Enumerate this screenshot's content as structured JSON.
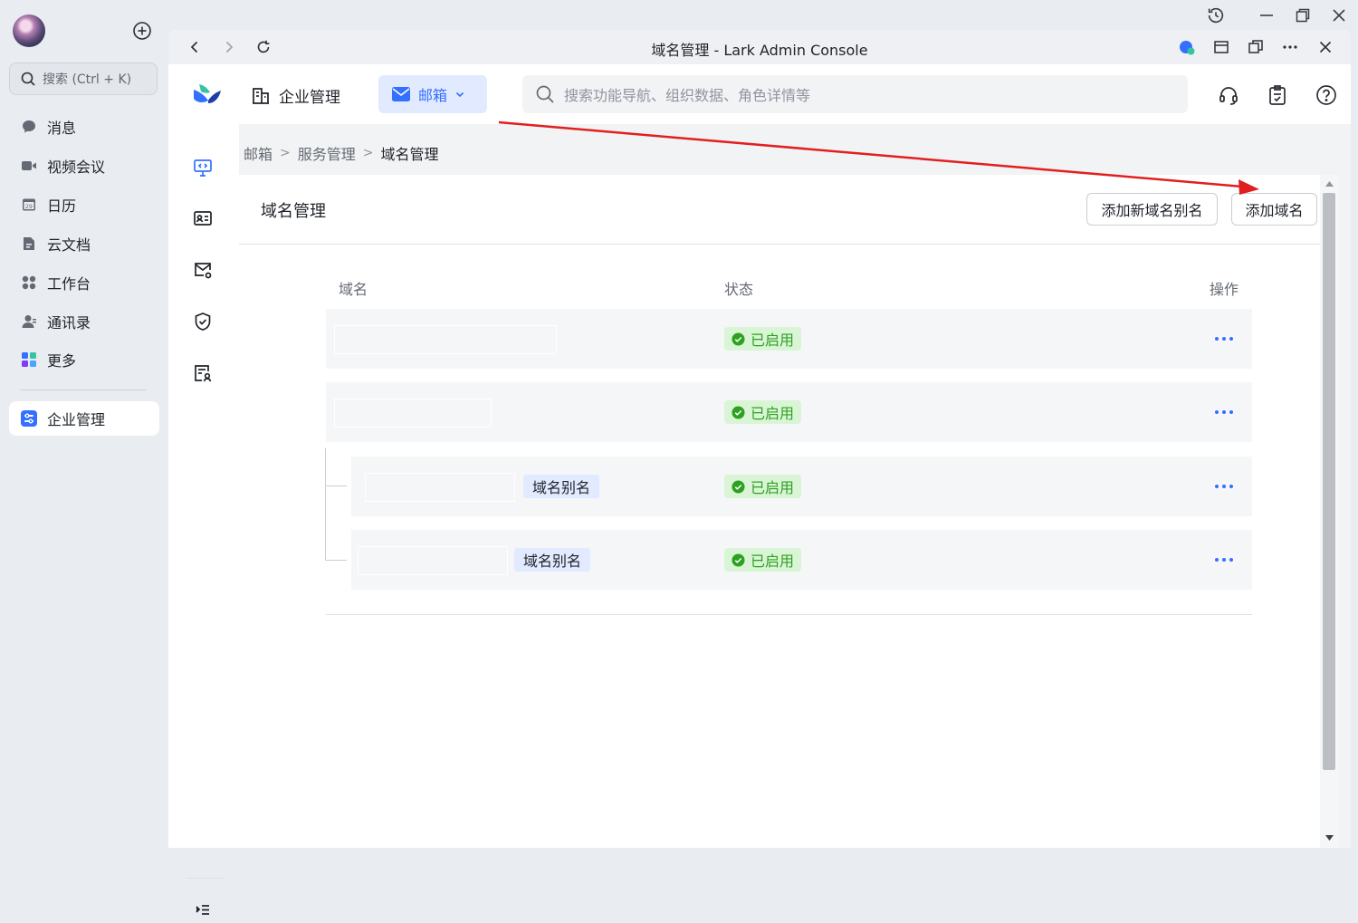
{
  "sidebar": {
    "search_placeholder": "搜索 (Ctrl + K)",
    "items": [
      {
        "label": "消息",
        "icon": "message-icon"
      },
      {
        "label": "视频会议",
        "icon": "video-icon"
      },
      {
        "label": "日历",
        "icon": "calendar-icon",
        "badge": "29"
      },
      {
        "label": "云文档",
        "icon": "docs-icon"
      },
      {
        "label": "工作台",
        "icon": "workplace-icon"
      },
      {
        "label": "通讯录",
        "icon": "contacts-icon"
      },
      {
        "label": "更多",
        "icon": "more-apps-icon"
      }
    ],
    "active_item": {
      "label": "企业管理",
      "icon": "admin-icon"
    }
  },
  "window": {
    "title": "域名管理 - Lark Admin Console"
  },
  "header": {
    "app_title": "企业管理",
    "module_tab": "邮箱",
    "search_placeholder": "搜索功能导航、组织数据、角色详情等"
  },
  "breadcrumb": {
    "items": [
      "邮箱",
      "服务管理",
      "域名管理"
    ],
    "separator": ">"
  },
  "page": {
    "title": "域名管理",
    "add_alias_button": "添加新域名别名",
    "add_domain_button": "添加域名",
    "columns": {
      "domain": "域名",
      "status": "状态",
      "actions": "操作"
    },
    "rows": [
      {
        "type": "domain",
        "status": "已启用"
      },
      {
        "type": "domain",
        "status": "已启用"
      },
      {
        "type": "alias",
        "alias_tag": "域名别名",
        "status": "已启用"
      },
      {
        "type": "alias",
        "alias_tag": "域名别名",
        "status": "已启用"
      }
    ]
  },
  "colors": {
    "accent": "#3370ff",
    "status_green": "#2ea121",
    "status_bg": "#d9f5d6",
    "annotation_arrow": "#e02020"
  }
}
